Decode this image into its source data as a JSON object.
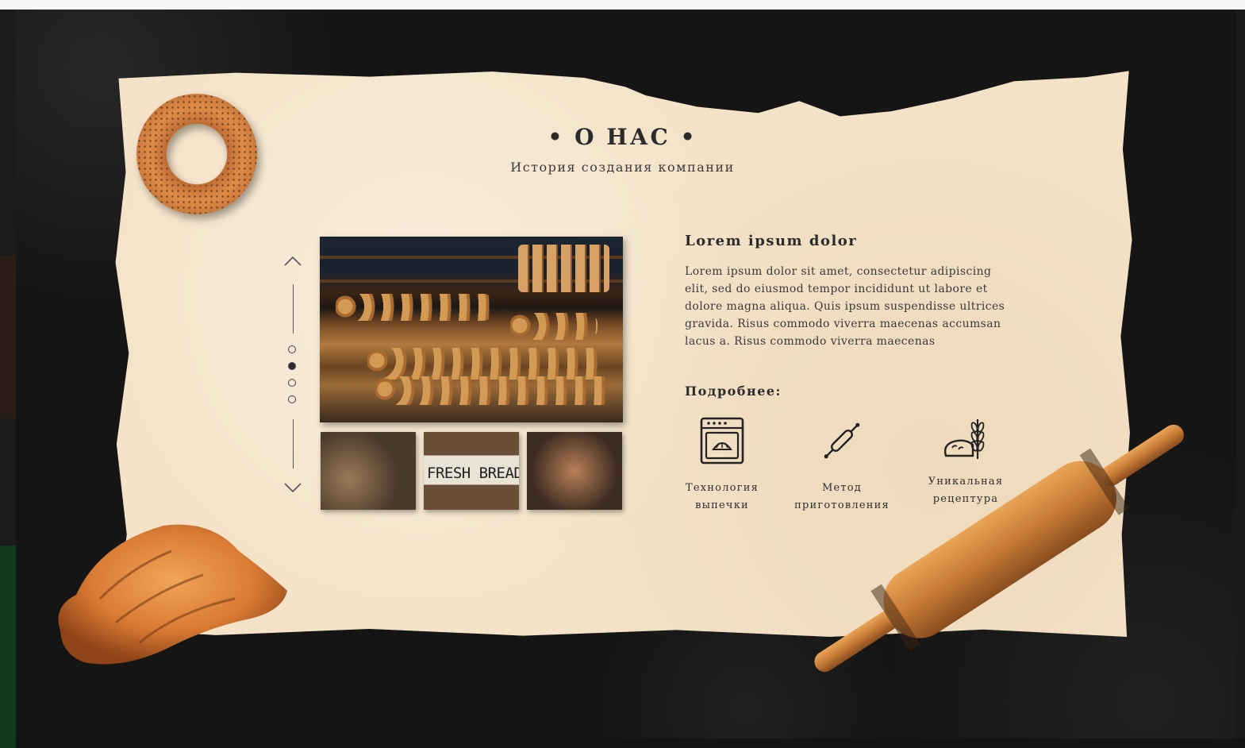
{
  "section": {
    "title": "• О НАС •",
    "subtitle": "История создания компании"
  },
  "gallery": {
    "up_icon": "chevron-up-icon",
    "down_icon": "chevron-down-icon",
    "dots_count": 4,
    "active_dot": 2,
    "thumb_sign": "FRESH BREAD"
  },
  "content": {
    "heading": "Lorem ipsum dolor",
    "body": "Lorem ipsum dolor sit amet, consectetur adipiscing elit, sed do eiusmod tempor incididunt ut labore et dolore magna aliqua. Quis ipsum suspendisse ultrices gravida. Risus commodo viverra maecenas accumsan lacus a. Risus commodo viverra maecenas",
    "more_label": "Подробнее:"
  },
  "features": [
    {
      "icon": "oven-icon",
      "line1": "Технология",
      "line2": "выпечки"
    },
    {
      "icon": "rolling-pin-icon",
      "line1": "Метод",
      "line2": "приготовления"
    },
    {
      "icon": "bread-wheat-icon",
      "line1": "Уникальная",
      "line2": "рецептура"
    }
  ],
  "colors": {
    "background": "#141414",
    "paper": "#f4e3c9",
    "text": "#2b2b2b",
    "accent_wood": "#c77a35"
  }
}
